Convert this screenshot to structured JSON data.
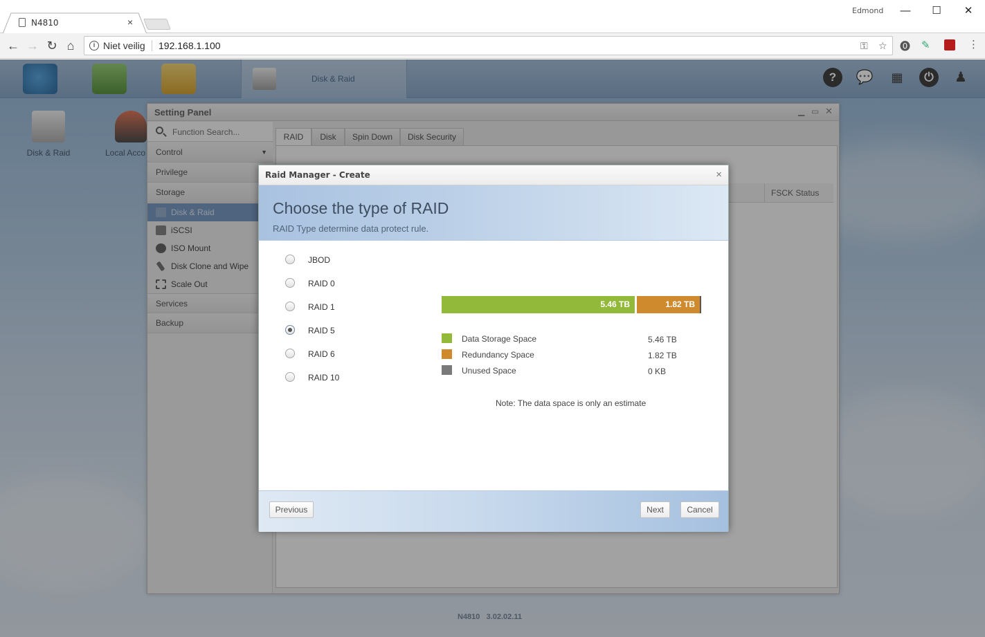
{
  "browser": {
    "tab_title": "N4810",
    "tab_close": "×",
    "profile_name": "Edmond",
    "window_minimize": "—",
    "window_maximize": "☐",
    "window_close": "✕",
    "security_label": "Niet veilig",
    "url": "192.168.1.100"
  },
  "nas": {
    "topbar_active_label": "Disk & Raid",
    "help_icon_glyph": "?",
    "desktop_shortcuts": [
      "Disk & Raid",
      "Local Acco"
    ],
    "footer_model": "N4810",
    "footer_version": "3.02.02.11"
  },
  "setting_panel": {
    "title": "Setting Panel",
    "search_placeholder": "Function Search...",
    "sections": {
      "control": "Control",
      "privilege": "Privilege",
      "storage": "Storage",
      "services": "Services",
      "backup": "Backup"
    },
    "storage_items": [
      "Disk & Raid",
      "iSCSI",
      "ISO Mount",
      "Disk Clone and Wipe",
      "Scale Out"
    ],
    "tabs": [
      "RAID",
      "Disk",
      "Spin Down",
      "Disk Security"
    ],
    "column_fsck": "FSCK Status"
  },
  "modal": {
    "title": "Raid Manager - Create",
    "close": "×",
    "heading": "Choose the type of RAID",
    "subheading": "RAID Type determine data protect rule.",
    "raid_options": [
      "JBOD",
      "RAID 0",
      "RAID 1",
      "RAID 5",
      "RAID 6",
      "RAID 10"
    ],
    "selected_option": "RAID 5",
    "capacity_bar": {
      "data_label": "5.46 TB",
      "redundancy_label": "1.82 TB",
      "data_fraction": 0.75,
      "redundancy_fraction": 0.25
    },
    "legend": [
      {
        "label": "Data Storage Space",
        "value": "5.46 TB",
        "color": "#93b93b"
      },
      {
        "label": "Redundancy Space",
        "value": "1.82 TB",
        "color": "#cf8a2e"
      },
      {
        "label": "Unused Space",
        "value": "0 KB",
        "color": "#7a7a7a"
      }
    ],
    "note": "Note: The data space is only an estimate",
    "buttons": {
      "previous": "Previous",
      "next": "Next",
      "cancel": "Cancel"
    }
  },
  "colors": {
    "data_bar": "#93b93b",
    "redundancy_bar": "#cf8a2e",
    "sidebar_active": "#6b8fbe"
  }
}
